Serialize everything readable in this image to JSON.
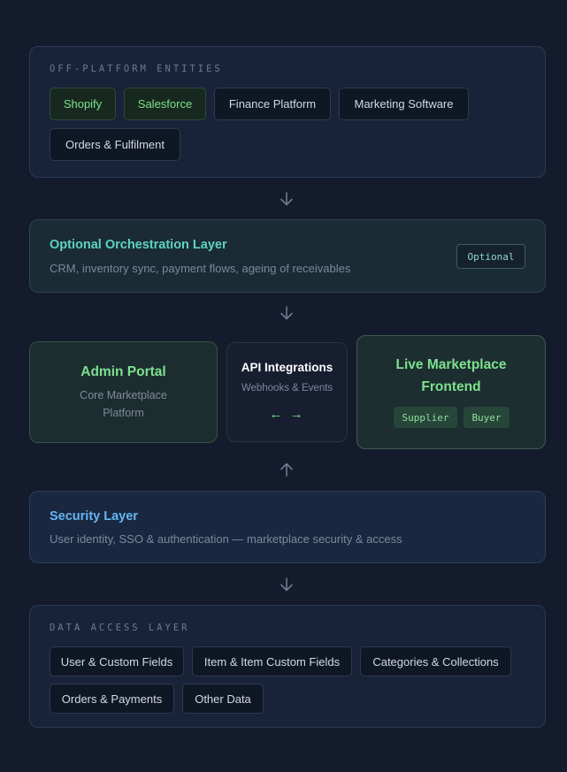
{
  "off_platform": {
    "label": "OFF-PLATFORM ENTITIES",
    "chips": [
      {
        "label": "Shopify"
      },
      {
        "label": "Salesforce"
      },
      {
        "label": "Finance Platform"
      },
      {
        "label": "Marketing Software"
      },
      {
        "label": "Orders & Fulfilment"
      }
    ]
  },
  "orchestration": {
    "title": "Optional Orchestration Layer",
    "subtitle": "CRM, inventory sync, payment flows, ageing of receivables",
    "badge": "Optional"
  },
  "admin_portal": {
    "title": "Admin Portal",
    "subtitle_line1": "Core Marketplace",
    "subtitle_line2": "Platform"
  },
  "api_integrations": {
    "title": "API Integrations",
    "subtitle": "Webhooks & Events",
    "arrows": "← →"
  },
  "live_marketplace": {
    "title_line1": "Live Marketplace",
    "title_line2": "Frontend",
    "tags": [
      {
        "label": "Supplier"
      },
      {
        "label": "Buyer"
      }
    ]
  },
  "security": {
    "title": "Security Layer",
    "subtitle": "User identity, SSO & authentication — marketplace security & access"
  },
  "data_access": {
    "label": "DATA ACCESS LAYER",
    "chips": [
      {
        "label": "User & Custom Fields"
      },
      {
        "label": "Item & Item Custom Fields"
      },
      {
        "label": "Categories & Collections"
      },
      {
        "label": "Orders & Payments"
      },
      {
        "label": "Other Data"
      }
    ]
  },
  "colors": {
    "background": "#131b2c",
    "panel": "#18233a",
    "teal_title": "#5fd3bf",
    "green_title": "#7ee08f",
    "blue_title": "#67b5f5",
    "arrow": "#6f7b8f"
  },
  "icons": {
    "connector": "arrow-down-icon",
    "connector_up": "arrow-up-icon"
  }
}
